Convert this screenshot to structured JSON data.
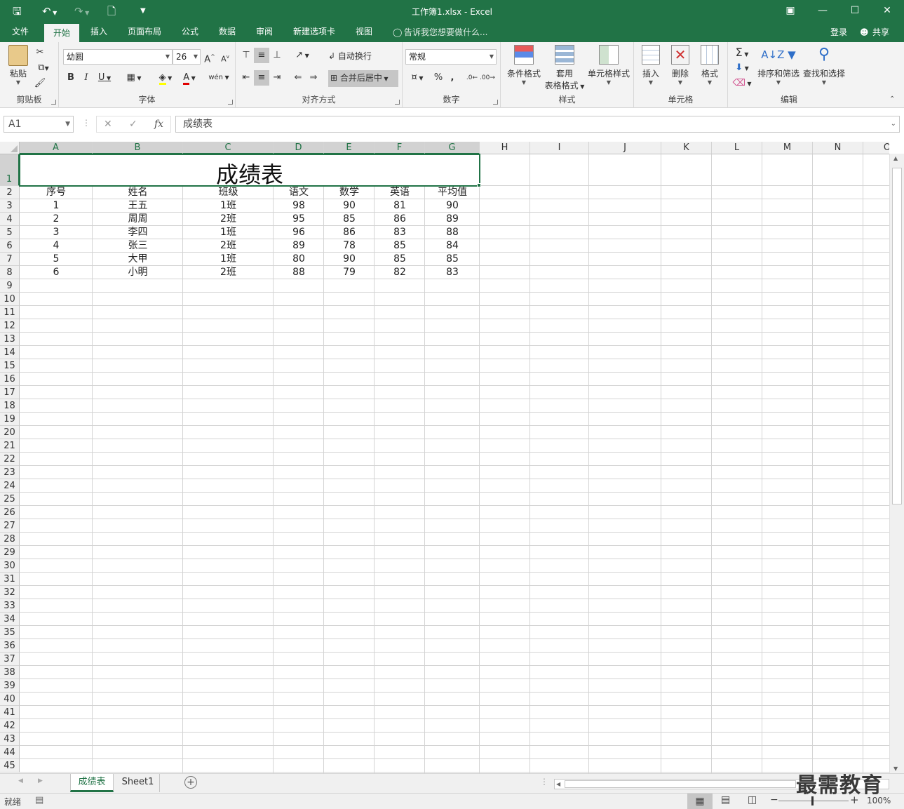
{
  "window": {
    "title": "工作簿1.xlsx - Excel"
  },
  "menu": {
    "tabs": [
      "文件",
      "开始",
      "插入",
      "页面布局",
      "公式",
      "数据",
      "审阅",
      "新建选项卡",
      "视图"
    ],
    "tellme": "告诉我您想要做什么...",
    "login": "登录",
    "share": "共享"
  },
  "ribbon": {
    "clipboard": {
      "label": "剪贴板",
      "paste": "粘贴"
    },
    "font": {
      "label": "字体",
      "name": "幼圆",
      "size": "26"
    },
    "alignment": {
      "label": "对齐方式",
      "wrap": "自动换行",
      "merge": "合并后居中"
    },
    "number": {
      "label": "数字",
      "format": "常规"
    },
    "styles": {
      "label": "样式",
      "conditional": "条件格式",
      "table1": "套用",
      "table2": "表格格式",
      "cell": "单元格样式"
    },
    "cells": {
      "label": "单元格",
      "insert": "插入",
      "delete": "删除",
      "format": "格式"
    },
    "editing": {
      "label": "编辑",
      "sort": "排序和筛选",
      "find": "查找和选择"
    }
  },
  "formula_bar": {
    "name_box": "A1",
    "content": "成绩表"
  },
  "sheet": {
    "columns": [
      "A",
      "B",
      "C",
      "D",
      "E",
      "F",
      "G",
      "H",
      "I",
      "J",
      "K",
      "L",
      "M",
      "N",
      "O"
    ],
    "rows": [
      "1",
      "2",
      "3",
      "4",
      "5",
      "6",
      "7",
      "8",
      "9",
      "10",
      "11",
      "12",
      "13",
      "14",
      "15",
      "16",
      "17",
      "18",
      "19",
      "20",
      "21",
      "22",
      "23",
      "24",
      "25",
      "26",
      "27",
      "28",
      "29",
      "30",
      "31",
      "32",
      "33",
      "34",
      "35",
      "36",
      "37",
      "38",
      "39",
      "40",
      "41",
      "42",
      "43",
      "44",
      "45"
    ],
    "title": "成绩表",
    "headers": [
      "序号",
      "姓名",
      "班级",
      "语文",
      "数学",
      "英语",
      "平均值"
    ],
    "data": [
      [
        "1",
        "王五",
        "1班",
        "98",
        "90",
        "81",
        "90"
      ],
      [
        "2",
        "周周",
        "2班",
        "95",
        "85",
        "86",
        "89"
      ],
      [
        "3",
        "李四",
        "1班",
        "96",
        "86",
        "83",
        "88"
      ],
      [
        "4",
        "张三",
        "2班",
        "89",
        "78",
        "85",
        "84"
      ],
      [
        "5",
        "大甲",
        "1班",
        "80",
        "90",
        "85",
        "85"
      ],
      [
        "6",
        "小明",
        "2班",
        "88",
        "79",
        "82",
        "83"
      ]
    ]
  },
  "sheet_tabs": [
    "成绩表",
    "Sheet1"
  ],
  "status": {
    "ready": "就绪",
    "zoom": "100%"
  },
  "watermark": "最需教育"
}
